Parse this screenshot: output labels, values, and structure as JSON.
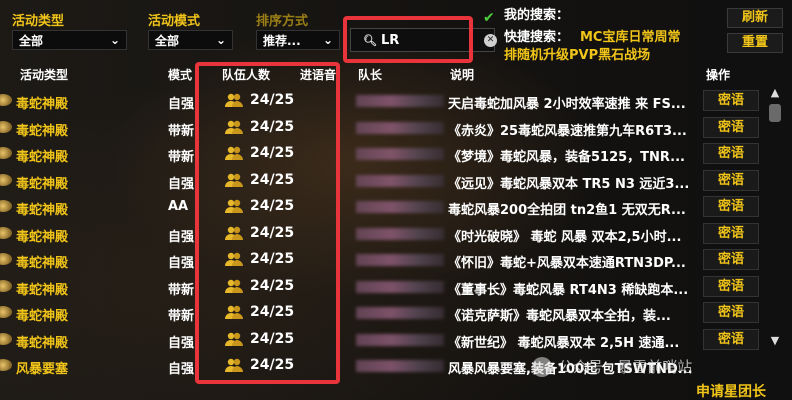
{
  "filters": {
    "activity_type_label": "活动类型",
    "activity_type_value": "全部",
    "activity_mode_label": "活动模式",
    "activity_mode_value": "全部",
    "sort_label": "排序方式",
    "sort_value": "推荐...",
    "search_value": "LR"
  },
  "my_search": {
    "label": "我的搜索：",
    "quick_label": "快捷搜索：",
    "quick_line1": "MC宝库日常周常",
    "quick_line2": "排随机升级PVP黑石战场"
  },
  "buttons": {
    "refresh": "刷新",
    "reset": "重置",
    "apply": "申请星团长"
  },
  "columns": {
    "activity_type": "活动类型",
    "mode": "模式",
    "team_size": "队伍人数",
    "voice": "进语音",
    "leader": "队长",
    "description": "说明",
    "action": "操作"
  },
  "rows": [
    {
      "name": "毒蛇神殿",
      "mode": "自强",
      "count": "24/25",
      "desc": "天启毒蛇加风暴 2小时效率速推 来 FS...",
      "action": "密语"
    },
    {
      "name": "毒蛇神殿",
      "mode": "带新",
      "count": "24/25",
      "desc": "《赤炎》25毒蛇风暴速推第九车R6T3...",
      "action": "密语"
    },
    {
      "name": "毒蛇神殿",
      "mode": "带新",
      "count": "24/25",
      "desc": "《梦境》毒蛇风暴，装备5125，TNR...",
      "action": "密语"
    },
    {
      "name": "毒蛇神殿",
      "mode": "自强",
      "count": "24/25",
      "desc": "《远见》毒蛇风暴双本 TR5 N3 远近3...",
      "action": "密语"
    },
    {
      "name": "毒蛇神殿",
      "mode": "AA",
      "count": "24/25",
      "desc": "毒蛇风暴200全拍团 tn2鱼1 无双无R...",
      "action": "密语"
    },
    {
      "name": "毒蛇神殿",
      "mode": "自强",
      "count": "24/25",
      "desc": "《时光破晓》 毒蛇 风暴 双本2,5小时...",
      "action": "密语"
    },
    {
      "name": "毒蛇神殿",
      "mode": "自强",
      "count": "24/25",
      "desc": "《怀旧》毒蛇+风暴双本速通RTN3DP...",
      "action": "密语"
    },
    {
      "name": "毒蛇神殿",
      "mode": "带新",
      "count": "24/25",
      "desc": "《董事长》毒蛇风暴 RT4N3 稀缺跑本...",
      "action": "密语"
    },
    {
      "name": "毒蛇神殿",
      "mode": "带新",
      "count": "24/25",
      "desc": "《诺克萨斯》毒蛇风暴双本全拍，装...",
      "action": "密语"
    },
    {
      "name": "毒蛇神殿",
      "mode": "自强",
      "count": "24/25",
      "desc": "《新世纪》 毒蛇风暴双本 2,5H 速通...",
      "action": "密语"
    },
    {
      "name": "风暴要塞",
      "mode": "自强",
      "count": "24/25",
      "desc": "风暴风暴要塞,装备100起 包TSWTND...",
      "action": "密语"
    }
  ],
  "watermark": "公众号 · 暴雪前哨站",
  "colors": {
    "accent": "#f0c419",
    "highlight_box": "#e8343a",
    "confirm": "#4ccf3a"
  },
  "icons": {
    "search": "magnifier-icon",
    "clear": "clear-icon",
    "confirm": "check-icon",
    "group": "group-icon",
    "dropdown": "chevron-down-icon"
  }
}
